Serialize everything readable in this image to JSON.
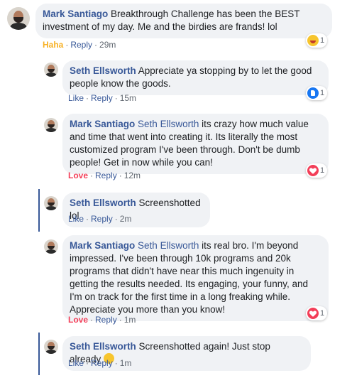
{
  "comments": [
    {
      "author": "Mark Santiago",
      "mention": "",
      "text": " Breakthrough Challenge has been the BEST investment of my day. Me and the birdies are frands! lol",
      "reaction_label": "Haha",
      "reply_label": "Reply",
      "time": "29m",
      "reaction_count": "1"
    },
    {
      "author": "Seth Ellsworth",
      "mention": "",
      "text": " Appreciate ya stopping by to let the good people know the goods.",
      "reaction_label": "Like",
      "reply_label": "Reply",
      "time": "15m",
      "reaction_count": "1"
    },
    {
      "author": "Mark Santiago",
      "mention": "Seth Ellsworth",
      "text": " its crazy how much value and time that went into creating it. Its literally the most customized program I've been through. Don't be dumb people! Get in now while you can!",
      "reaction_label": "Love",
      "reply_label": "Reply",
      "time": "12m",
      "reaction_count": "1"
    },
    {
      "author": "Seth Ellsworth",
      "mention": "",
      "text": " Screenshotted lol",
      "reaction_label": "Like",
      "reply_label": "Reply",
      "time": "2m",
      "reaction_count": ""
    },
    {
      "author": "Mark Santiago",
      "mention": "Seth Ellsworth",
      "text": " its real bro. I'm beyond impressed. I've been through 10k programs and 20k programs that didn't have near this much ingenuity in getting the results needed. Its engaging, your funny, and I'm on track for the first time in a long freaking while. Appreciate you more than you know!",
      "reaction_label": "Love",
      "reply_label": "Reply",
      "time": "1m",
      "reaction_count": "1"
    },
    {
      "author": "Seth Ellsworth",
      "mention": "",
      "text": " Screenshotted again! Just stop already",
      "reaction_label": "Like",
      "reply_label": "Reply",
      "time": "1m",
      "reaction_count": ""
    }
  ],
  "colors": {
    "link": "#385898",
    "haha": "#f7b125",
    "love": "#f33e58",
    "like": "#1877f2",
    "bubble": "#f0f2f5"
  },
  "icons": {
    "haha": "haha-reaction-icon",
    "like": "like-reaction-icon",
    "love": "love-reaction-icon",
    "emoji": "laughing-emoji-icon"
  }
}
